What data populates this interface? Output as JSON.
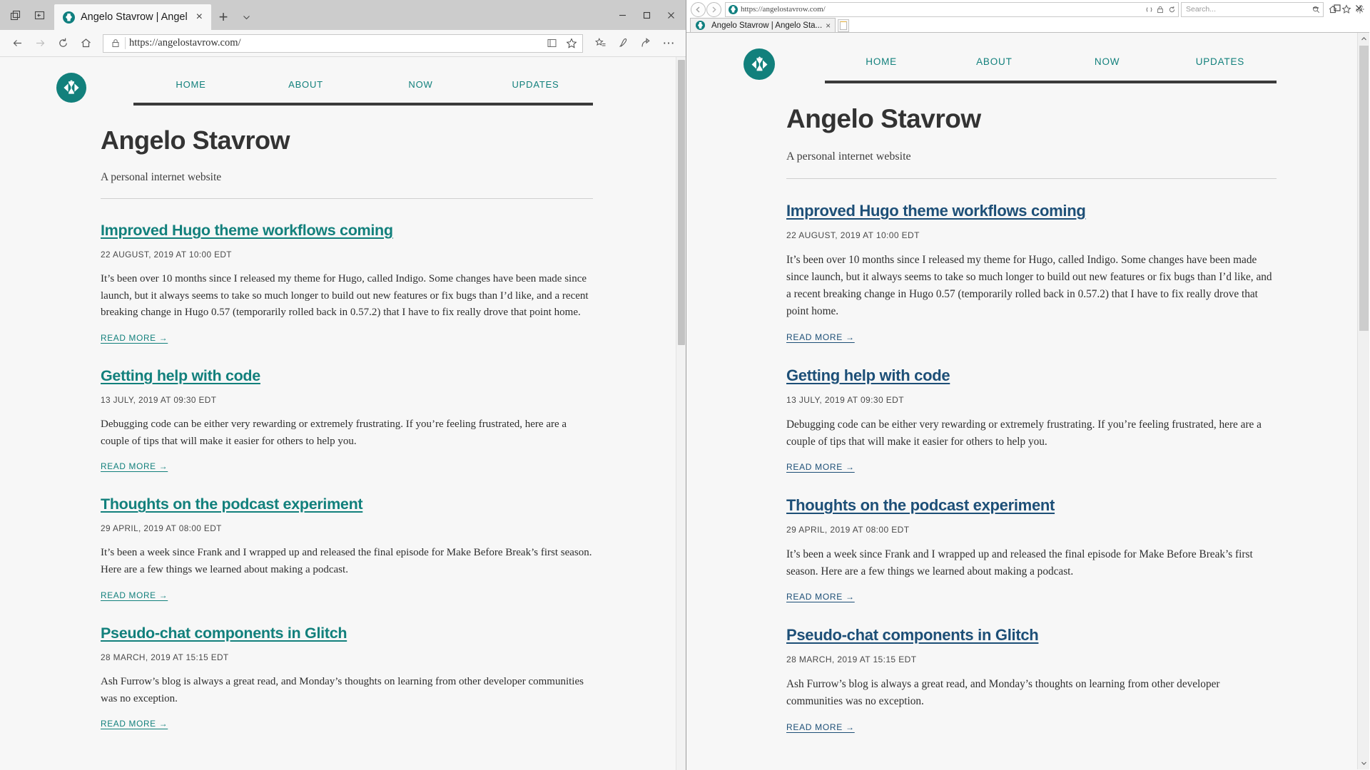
{
  "left_window": {
    "browser": "edge",
    "tab": {
      "title": "Angelo Stavrow | Angel",
      "close_label": "×",
      "favicon": "site-logo-icon"
    },
    "tabstrip": {
      "set_tabs_aside_label": "set-tabs-aside-icon",
      "restore_tabs_label": "restore-tabs-icon",
      "new_tab_label": "+",
      "tab_preview_label": "⌄"
    },
    "toolbar": {
      "back_label": "←",
      "forward_label": "→",
      "refresh_label": "⟳",
      "home_label": "⌂",
      "lock_label": "lock-icon",
      "url": "https://angelostavrow.com/",
      "reading_view_label": "reading-view-icon",
      "favorite_label": "☆",
      "favorites_hub_label": "favorites-hub-icon",
      "notes_label": "web-notes-icon",
      "share_label": "share-icon",
      "more_label": "⋯"
    },
    "window_controls": {
      "minimize": "–",
      "maximize": "☐",
      "close": "✕"
    }
  },
  "right_window": {
    "browser": "internet-explorer",
    "nav": {
      "back_label": "‹",
      "forward_label": "›",
      "url": "https://angelostavrow.com/",
      "compatibility_label": "compatibility-view-icon",
      "lock_label": "lock-icon",
      "refresh_label": "⟳",
      "search_placeholder": "Search...",
      "search_label": "search-icon",
      "home_label": "⌂",
      "favorites_label": "☆",
      "tools_label": "gear-icon"
    },
    "tab": {
      "title": "Angelo Stavrow | Angelo Sta...",
      "close_label": "×",
      "new_tab_label": "new-tab-icon"
    },
    "window_controls": {
      "minimize": "–",
      "maximize": "☐",
      "close": "✕"
    }
  },
  "site": {
    "logo_alt": "site-logo-icon",
    "nav": [
      {
        "label": "HOME",
        "name": "nav-home"
      },
      {
        "label": "ABOUT",
        "name": "nav-about"
      },
      {
        "label": "NOW",
        "name": "nav-now"
      },
      {
        "label": "UPDATES",
        "name": "nav-updates"
      }
    ],
    "title": "Angelo Stavrow",
    "tagline": "A personal internet website",
    "read_more_label": "READ MORE →",
    "posts": [
      {
        "title": "Improved Hugo theme workflows coming",
        "date": "22 AUGUST, 2019 AT 10:00 EDT",
        "excerpt": "It’s been over 10 months since I released my theme for Hugo, called Indigo. Some changes have been made since launch, but it always seems to take so much longer to build out new features or fix bugs than I’d like, and a recent breaking change in Hugo 0.57 (temporarily rolled back in 0.57.2) that I have to fix really drove that point home."
      },
      {
        "title": "Getting help with code",
        "date": "13 JULY, 2019 AT 09:30 EDT",
        "excerpt": "Debugging code can be either very rewarding or extremely frustrating. If you’re feeling frustrated, here are a couple of tips that will make it easier for others to help you."
      },
      {
        "title": "Thoughts on the podcast experiment",
        "date": "29 APRIL, 2019 AT 08:00 EDT",
        "excerpt": "It’s been a week since Frank and I wrapped up and released the final episode for Make Before Break’s first season. Here are a few things we learned about making a podcast."
      },
      {
        "title": "Pseudo-chat components in Glitch",
        "date": "28 MARCH, 2019 AT 15:15 EDT",
        "excerpt": "Ash Furrow’s blog is always a great read, and Monday’s thoughts on learning from other developer communities was no exception."
      }
    ],
    "colors": {
      "accent_teal": "#12807c",
      "ie_link": "#1d4f77",
      "page_bg": "#f7f7f7",
      "heading": "#333333"
    }
  }
}
